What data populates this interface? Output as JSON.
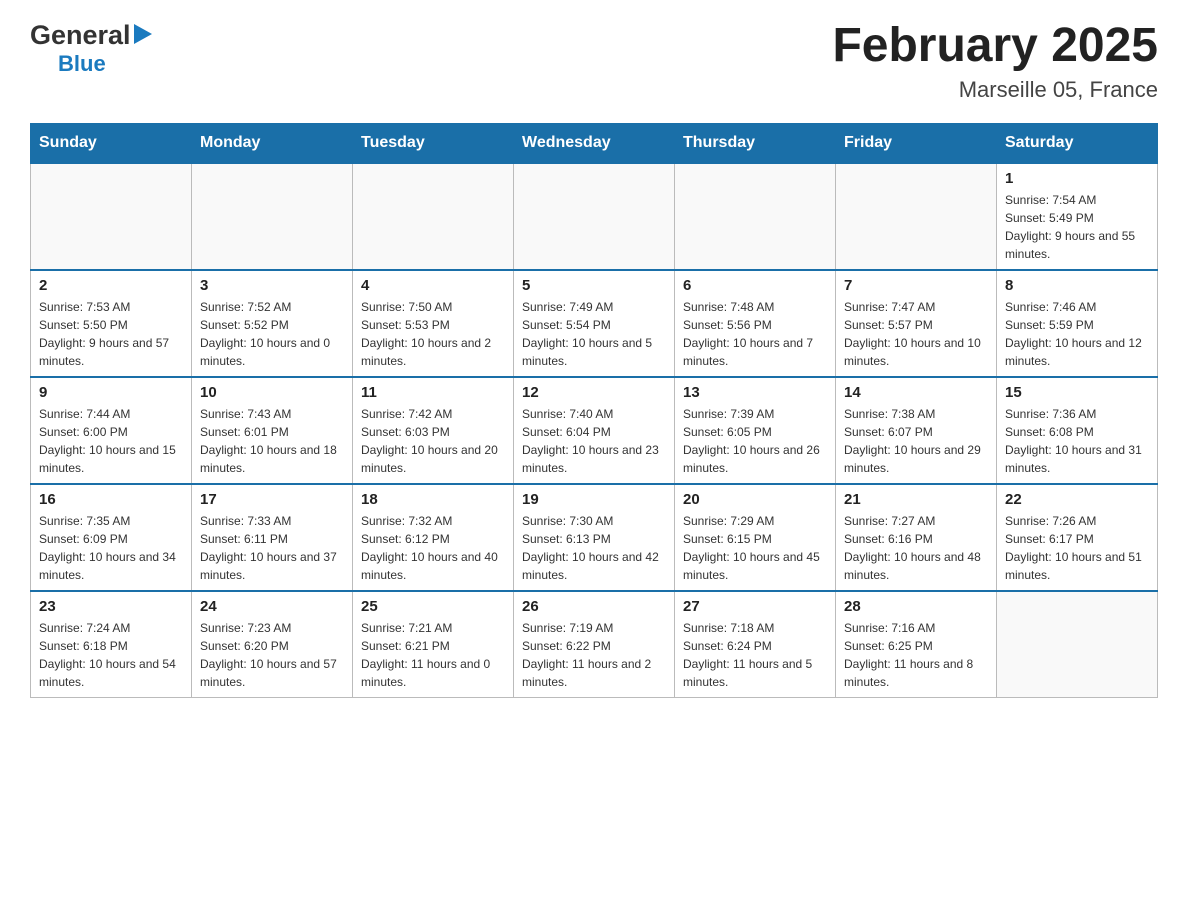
{
  "header": {
    "logo_general": "General",
    "logo_blue": "Blue",
    "month_title": "February 2025",
    "location": "Marseille 05, France"
  },
  "days_of_week": [
    "Sunday",
    "Monday",
    "Tuesday",
    "Wednesday",
    "Thursday",
    "Friday",
    "Saturday"
  ],
  "weeks": [
    {
      "days": [
        {
          "num": "",
          "info": ""
        },
        {
          "num": "",
          "info": ""
        },
        {
          "num": "",
          "info": ""
        },
        {
          "num": "",
          "info": ""
        },
        {
          "num": "",
          "info": ""
        },
        {
          "num": "",
          "info": ""
        },
        {
          "num": "1",
          "info": "Sunrise: 7:54 AM\nSunset: 5:49 PM\nDaylight: 9 hours and 55 minutes."
        }
      ]
    },
    {
      "days": [
        {
          "num": "2",
          "info": "Sunrise: 7:53 AM\nSunset: 5:50 PM\nDaylight: 9 hours and 57 minutes."
        },
        {
          "num": "3",
          "info": "Sunrise: 7:52 AM\nSunset: 5:52 PM\nDaylight: 10 hours and 0 minutes."
        },
        {
          "num": "4",
          "info": "Sunrise: 7:50 AM\nSunset: 5:53 PM\nDaylight: 10 hours and 2 minutes."
        },
        {
          "num": "5",
          "info": "Sunrise: 7:49 AM\nSunset: 5:54 PM\nDaylight: 10 hours and 5 minutes."
        },
        {
          "num": "6",
          "info": "Sunrise: 7:48 AM\nSunset: 5:56 PM\nDaylight: 10 hours and 7 minutes."
        },
        {
          "num": "7",
          "info": "Sunrise: 7:47 AM\nSunset: 5:57 PM\nDaylight: 10 hours and 10 minutes."
        },
        {
          "num": "8",
          "info": "Sunrise: 7:46 AM\nSunset: 5:59 PM\nDaylight: 10 hours and 12 minutes."
        }
      ]
    },
    {
      "days": [
        {
          "num": "9",
          "info": "Sunrise: 7:44 AM\nSunset: 6:00 PM\nDaylight: 10 hours and 15 minutes."
        },
        {
          "num": "10",
          "info": "Sunrise: 7:43 AM\nSunset: 6:01 PM\nDaylight: 10 hours and 18 minutes."
        },
        {
          "num": "11",
          "info": "Sunrise: 7:42 AM\nSunset: 6:03 PM\nDaylight: 10 hours and 20 minutes."
        },
        {
          "num": "12",
          "info": "Sunrise: 7:40 AM\nSunset: 6:04 PM\nDaylight: 10 hours and 23 minutes."
        },
        {
          "num": "13",
          "info": "Sunrise: 7:39 AM\nSunset: 6:05 PM\nDaylight: 10 hours and 26 minutes."
        },
        {
          "num": "14",
          "info": "Sunrise: 7:38 AM\nSunset: 6:07 PM\nDaylight: 10 hours and 29 minutes."
        },
        {
          "num": "15",
          "info": "Sunrise: 7:36 AM\nSunset: 6:08 PM\nDaylight: 10 hours and 31 minutes."
        }
      ]
    },
    {
      "days": [
        {
          "num": "16",
          "info": "Sunrise: 7:35 AM\nSunset: 6:09 PM\nDaylight: 10 hours and 34 minutes."
        },
        {
          "num": "17",
          "info": "Sunrise: 7:33 AM\nSunset: 6:11 PM\nDaylight: 10 hours and 37 minutes."
        },
        {
          "num": "18",
          "info": "Sunrise: 7:32 AM\nSunset: 6:12 PM\nDaylight: 10 hours and 40 minutes."
        },
        {
          "num": "19",
          "info": "Sunrise: 7:30 AM\nSunset: 6:13 PM\nDaylight: 10 hours and 42 minutes."
        },
        {
          "num": "20",
          "info": "Sunrise: 7:29 AM\nSunset: 6:15 PM\nDaylight: 10 hours and 45 minutes."
        },
        {
          "num": "21",
          "info": "Sunrise: 7:27 AM\nSunset: 6:16 PM\nDaylight: 10 hours and 48 minutes."
        },
        {
          "num": "22",
          "info": "Sunrise: 7:26 AM\nSunset: 6:17 PM\nDaylight: 10 hours and 51 minutes."
        }
      ]
    },
    {
      "days": [
        {
          "num": "23",
          "info": "Sunrise: 7:24 AM\nSunset: 6:18 PM\nDaylight: 10 hours and 54 minutes."
        },
        {
          "num": "24",
          "info": "Sunrise: 7:23 AM\nSunset: 6:20 PM\nDaylight: 10 hours and 57 minutes."
        },
        {
          "num": "25",
          "info": "Sunrise: 7:21 AM\nSunset: 6:21 PM\nDaylight: 11 hours and 0 minutes."
        },
        {
          "num": "26",
          "info": "Sunrise: 7:19 AM\nSunset: 6:22 PM\nDaylight: 11 hours and 2 minutes."
        },
        {
          "num": "27",
          "info": "Sunrise: 7:18 AM\nSunset: 6:24 PM\nDaylight: 11 hours and 5 minutes."
        },
        {
          "num": "28",
          "info": "Sunrise: 7:16 AM\nSunset: 6:25 PM\nDaylight: 11 hours and 8 minutes."
        },
        {
          "num": "",
          "info": ""
        }
      ]
    }
  ]
}
